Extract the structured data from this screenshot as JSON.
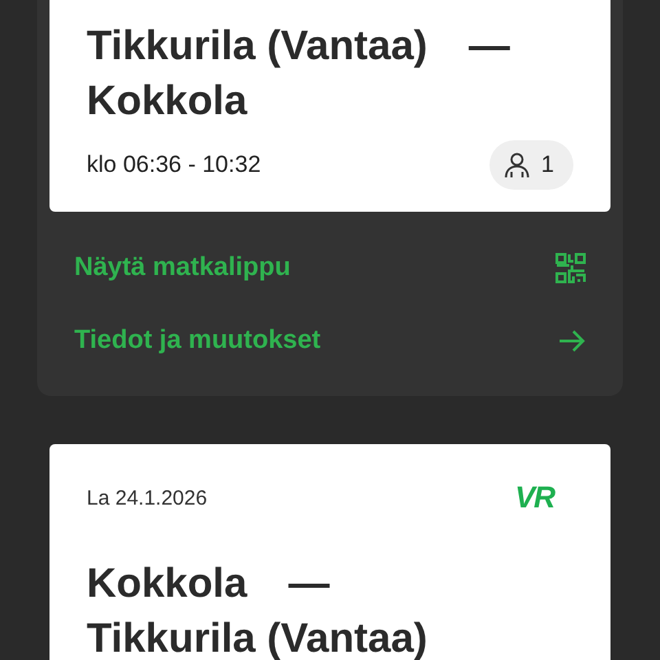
{
  "trips": [
    {
      "origin": "Tikkurila (Vantaa)",
      "separator": "—",
      "destination": "Kokkola",
      "time": "klo 06:36 - 10:32",
      "passengers": "1",
      "actions": [
        {
          "label": "Näytä matkalippu",
          "kind": "qr"
        },
        {
          "label": "Tiedot ja muutokset",
          "kind": "arrow"
        }
      ]
    },
    {
      "date": "La 24.1.2026",
      "logo": "VR",
      "origin": "Kokkola",
      "separator": "—",
      "destination": "Tikkurila (Vantaa)"
    }
  ]
}
